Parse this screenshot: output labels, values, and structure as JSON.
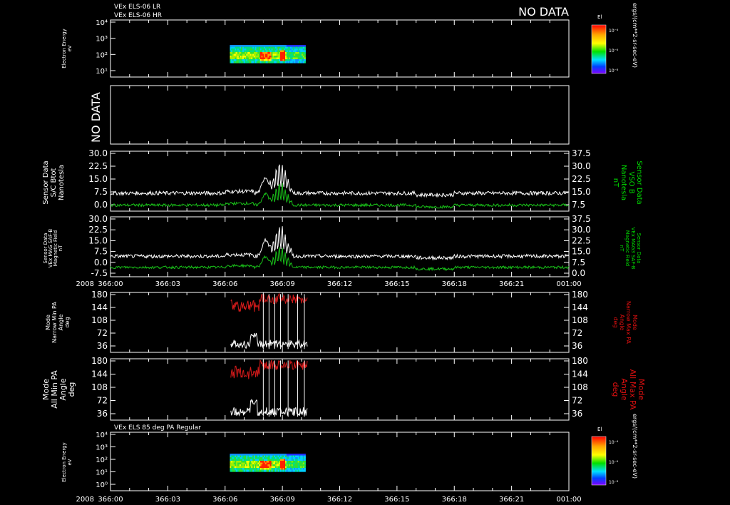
{
  "header": {
    "line1": "VEx ELS-06 LR",
    "line2": "VEx ELS-06 HR",
    "no_data": "NO DATA"
  },
  "footer_title": "VEx ELS 85 deg PA Regular",
  "panel2_no_data": "NO DATA",
  "year_label": "2008",
  "colors": {
    "white": "#ffffff",
    "green": "#19c219",
    "red": "#d41a1a",
    "green_label": "#00dd00",
    "red_label": "#e01010"
  },
  "colorbar": {
    "title": "El",
    "ticks": [
      "10⁻⁴",
      "10⁻⁶",
      "10⁻⁸"
    ],
    "unit": "ergs/(cm**2-sr-sec-eV)"
  },
  "chart_data": [
    {
      "type": "heatmap",
      "id": "els-energy-top",
      "ylabel": [
        "Electron Energy",
        "eV"
      ],
      "yticks": [
        "10⁴",
        "10³",
        "10²",
        "10¹"
      ],
      "x_time": [
        "366:06",
        "366:10"
      ]
    },
    {
      "type": "line",
      "id": "mag-vso",
      "ylabel_left": [
        "Sensor Data",
        "S/C Btot",
        "Nanotesla"
      ],
      "ylabel_right": [
        "Sensor Data",
        "VSO B",
        "Nanotesla",
        "nT"
      ],
      "left_ticks": [
        "30.0",
        "22.5",
        "15.0",
        "7.5",
        "0.0"
      ],
      "right_ticks": [
        "37.5",
        "30.0",
        "22.5",
        "15.0",
        "7.5"
      ],
      "left_ylim": [
        -5,
        30
      ]
    },
    {
      "type": "line",
      "id": "mag-saf",
      "ylabel_left": [
        "Sensor Data",
        "VEx MAG SAF-B",
        "Magnetic Field",
        "nT"
      ],
      "ylabel_right": [
        "Sensor Data",
        "VEx MAG3 SAF-B",
        "Magnetic Field",
        "nT"
      ],
      "left_ticks": [
        "30.0",
        "22.5",
        "15.0",
        "7.5",
        "0.0",
        "-7.5"
      ],
      "right_ticks": [
        "37.5",
        "30.0",
        "22.5",
        "15.0",
        "7.5",
        "0.0"
      ],
      "left_ylim": [
        -8,
        30
      ]
    },
    {
      "type": "line",
      "id": "pa-narrow",
      "ylabel_left": [
        "Mode",
        "Narrow Min PA",
        "Angle",
        "deg"
      ],
      "ylabel_right": [
        "Mode",
        "Narrow Max PA",
        "Angle",
        "deg"
      ],
      "ticks": [
        "180",
        "144",
        "108",
        "72",
        "36"
      ],
      "ylim": [
        0,
        180
      ]
    },
    {
      "type": "line",
      "id": "pa-all",
      "ylabel_left": [
        "Mode",
        "All Min PA",
        "Angle",
        "deg"
      ],
      "ylabel_right": [
        "Mode",
        "All Max PA",
        "Angle",
        "deg"
      ],
      "ticks": [
        "180",
        "144",
        "108",
        "72",
        "36"
      ],
      "ylim": [
        0,
        180
      ]
    },
    {
      "type": "heatmap",
      "id": "els-85deg",
      "ylabel": [
        "Electron Energy",
        "eV"
      ],
      "yticks": [
        "10⁴",
        "10³",
        "10²",
        "10¹",
        "10⁰"
      ],
      "x_time": [
        "366:06",
        "366:10"
      ]
    }
  ],
  "xticks": [
    "366:00",
    "366:03",
    "366:06",
    "366:09",
    "366:12",
    "366:15",
    "366:18",
    "366:21",
    "001:00"
  ]
}
